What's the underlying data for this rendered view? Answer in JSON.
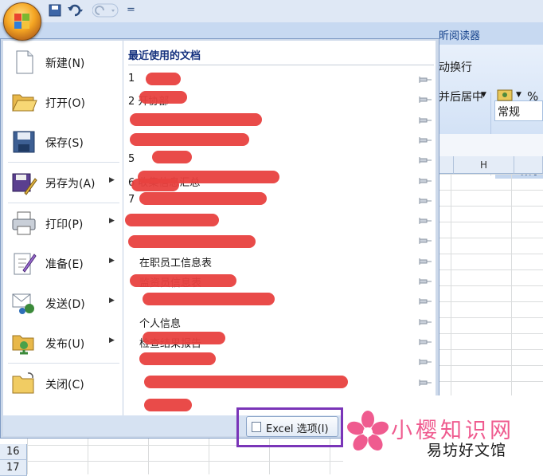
{
  "qat": {
    "undo_icon": "undo-icon",
    "redo_icon": "redo-icon",
    "customize": "="
  },
  "ribbon": {
    "tab_view_fragment": "昕阅读器",
    "wrap_text_fragment": "动换行",
    "merge_center_fragment": "并后居中",
    "number_format": "常规",
    "percent": "%",
    "group_number_fragment": "数字"
  },
  "sheet": {
    "column_h": "H",
    "row_16": "16",
    "row_17": "17"
  },
  "menu": {
    "items": [
      {
        "label": "新建(N)",
        "icon": "new-document-icon",
        "submenu": false
      },
      {
        "label": "打开(O)",
        "icon": "open-folder-icon",
        "submenu": false
      },
      {
        "label": "保存(S)",
        "icon": "save-disk-icon",
        "submenu": false
      },
      {
        "label": "另存为(A)",
        "icon": "save-as-icon",
        "submenu": true
      },
      {
        "label": "打印(P)",
        "icon": "printer-icon",
        "submenu": true
      },
      {
        "label": "准备(E)",
        "icon": "prepare-icon",
        "submenu": true
      },
      {
        "label": "发送(D)",
        "icon": "send-icon",
        "submenu": true
      },
      {
        "label": "发布(U)",
        "icon": "publish-icon",
        "submenu": true
      },
      {
        "label": "关闭(C)",
        "icon": "close-folder-icon",
        "submenu": false
      }
    ],
    "recent_title": "最近使用的文档",
    "recent_docs": [
      {
        "text": "1"
      },
      {
        "text": "2 开协部"
      },
      {
        "text": ""
      },
      {
        "text": ""
      },
      {
        "text": "5"
      },
      {
        "text": "6 收集信息汇总"
      },
      {
        "text": "7"
      },
      {
        "text": ""
      },
      {
        "text": ""
      },
      {
        "text": "在职员工信息表"
      },
      {
        "text": "监资员信息表"
      },
      {
        "text": ""
      },
      {
        "text": "个人信息"
      },
      {
        "text": "检查结果报告"
      },
      {
        "text": ""
      },
      {
        "text": ""
      },
      {
        "text": ""
      }
    ],
    "excel_options_label": "Excel 选项(I)"
  },
  "watermark": {
    "title": "小樱知识网",
    "subtitle": "易坊好文馆"
  }
}
